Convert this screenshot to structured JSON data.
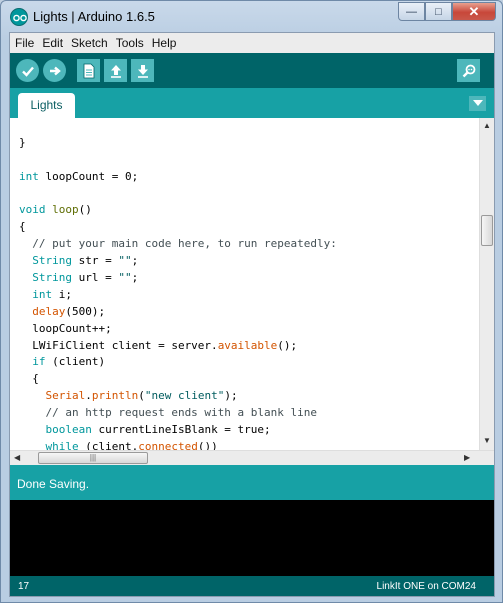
{
  "window": {
    "title": "Lights | Arduino 1.6.5",
    "controls": {
      "minimize": "—",
      "maximize": "□",
      "close": "✕"
    }
  },
  "menubar": {
    "items": [
      "File",
      "Edit",
      "Sketch",
      "Tools",
      "Help"
    ]
  },
  "toolbar": {
    "icons": [
      "verify-icon",
      "upload-icon",
      "new-icon",
      "open-icon",
      "save-icon",
      "serial-monitor-icon"
    ]
  },
  "tabs": [
    {
      "label": "Lights"
    }
  ],
  "editor": {
    "lines": [
      [
        {
          "t": "  ",
          "c": "plain"
        }
      ],
      [
        {
          "t": "}",
          "c": "plain"
        }
      ],
      [
        {
          "t": "",
          "c": "plain"
        }
      ],
      [
        {
          "t": "int",
          "c": "type"
        },
        {
          "t": " loopCount = 0;",
          "c": "plain"
        }
      ],
      [
        {
          "t": "",
          "c": "plain"
        }
      ],
      [
        {
          "t": "void",
          "c": "type"
        },
        {
          "t": " ",
          "c": "plain"
        },
        {
          "t": "loop",
          "c": "keyword"
        },
        {
          "t": "()",
          "c": "plain"
        }
      ],
      [
        {
          "t": "{",
          "c": "plain"
        }
      ],
      [
        {
          "t": "  // put your main code here, to run repeatedly:",
          "c": "comment"
        }
      ],
      [
        {
          "t": "  ",
          "c": "plain"
        },
        {
          "t": "String",
          "c": "type"
        },
        {
          "t": " str = ",
          "c": "plain"
        },
        {
          "t": "\"\"",
          "c": "string"
        },
        {
          "t": ";",
          "c": "plain"
        }
      ],
      [
        {
          "t": "  ",
          "c": "plain"
        },
        {
          "t": "String",
          "c": "type"
        },
        {
          "t": " url = ",
          "c": "plain"
        },
        {
          "t": "\"\"",
          "c": "string"
        },
        {
          "t": ";",
          "c": "plain"
        }
      ],
      [
        {
          "t": "  ",
          "c": "plain"
        },
        {
          "t": "int",
          "c": "type"
        },
        {
          "t": " i;",
          "c": "plain"
        }
      ],
      [
        {
          "t": "  ",
          "c": "plain"
        },
        {
          "t": "delay",
          "c": "function"
        },
        {
          "t": "(500);",
          "c": "plain"
        }
      ],
      [
        {
          "t": "  loopCount++;",
          "c": "plain"
        }
      ],
      [
        {
          "t": "  LWiFiClient client = server.",
          "c": "plain"
        },
        {
          "t": "available",
          "c": "function"
        },
        {
          "t": "();",
          "c": "plain"
        }
      ],
      [
        {
          "t": "  ",
          "c": "plain"
        },
        {
          "t": "if",
          "c": "type"
        },
        {
          "t": " (client)",
          "c": "plain"
        }
      ],
      [
        {
          "t": "  {",
          "c": "plain"
        }
      ],
      [
        {
          "t": "    ",
          "c": "plain"
        },
        {
          "t": "Serial",
          "c": "function"
        },
        {
          "t": ".",
          "c": "plain"
        },
        {
          "t": "println",
          "c": "function"
        },
        {
          "t": "(",
          "c": "plain"
        },
        {
          "t": "\"new client\"",
          "c": "string"
        },
        {
          "t": ");",
          "c": "plain"
        }
      ],
      [
        {
          "t": "    // an http request ends with a blank line",
          "c": "comment"
        }
      ],
      [
        {
          "t": "    ",
          "c": "plain"
        },
        {
          "t": "boolean",
          "c": "type"
        },
        {
          "t": " currentLineIsBlank = true;",
          "c": "plain"
        }
      ],
      [
        {
          "t": "    ",
          "c": "plain"
        },
        {
          "t": "while",
          "c": "type"
        },
        {
          "t": " (client.",
          "c": "plain"
        },
        {
          "t": "connected",
          "c": "function"
        },
        {
          "t": "())",
          "c": "plain"
        }
      ]
    ]
  },
  "syntax_colors": {
    "plain": "#000000",
    "type": "#00979c",
    "keyword": "#5e6d03",
    "function": "#d35400",
    "comment": "#434f54",
    "string": "#005c5f"
  },
  "status": {
    "message": "Done Saving."
  },
  "footer": {
    "line_number": "17",
    "board": "LinkIt ONE on COM24"
  },
  "colors": {
    "toolbar_bg": "#006468",
    "tabbar_bg": "#17a1a5",
    "button_bg": "#4db7bb",
    "console_bg": "#000000"
  }
}
